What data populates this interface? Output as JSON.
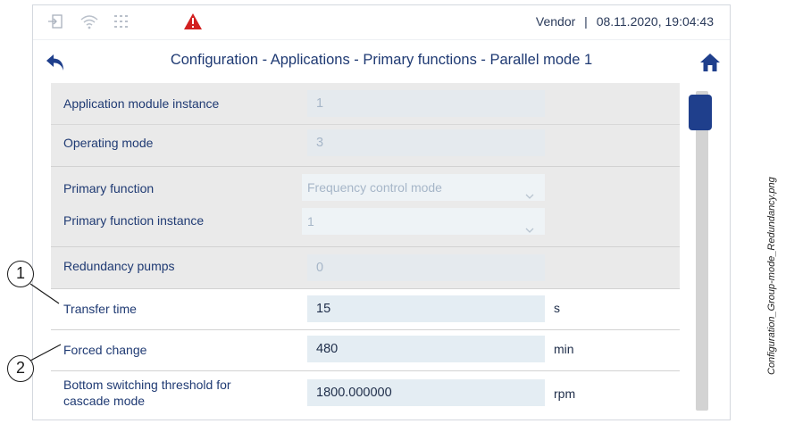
{
  "status_bar": {
    "vendor": "Vendor",
    "separator": "|",
    "datetime": "08.11.2020, 19:04:43",
    "warning_color": "#d22020"
  },
  "title_bar": {
    "title": "Configuration - Applications - Primary functions - Parallel mode 1"
  },
  "rows": {
    "app_module_instance": {
      "label": "Application module instance",
      "value": "1"
    },
    "operating_mode": {
      "label": "Operating mode",
      "value": "3"
    },
    "primary_function": {
      "label": "Primary function",
      "value": "Frequency control mode"
    },
    "primary_function_instance": {
      "label": "Primary function instance",
      "value": "1"
    },
    "redundancy_pumps": {
      "label": "Redundancy pumps",
      "value": "0"
    },
    "transfer_time": {
      "label": "Transfer time",
      "value": "15",
      "unit": "s"
    },
    "forced_change": {
      "label": "Forced change",
      "value": "480",
      "unit": "min"
    },
    "bottom_switching": {
      "label_line1": "Bottom switching threshold for",
      "label_line2": "cascade mode",
      "value": "1800.000000",
      "unit": "rpm"
    }
  },
  "callouts": {
    "one": "1",
    "two": "2"
  },
  "caption": "Configuration_Group-mode_Redundancy.png",
  "colors": {
    "accent": "#1f3f8c",
    "label": "#1f3a73"
  }
}
